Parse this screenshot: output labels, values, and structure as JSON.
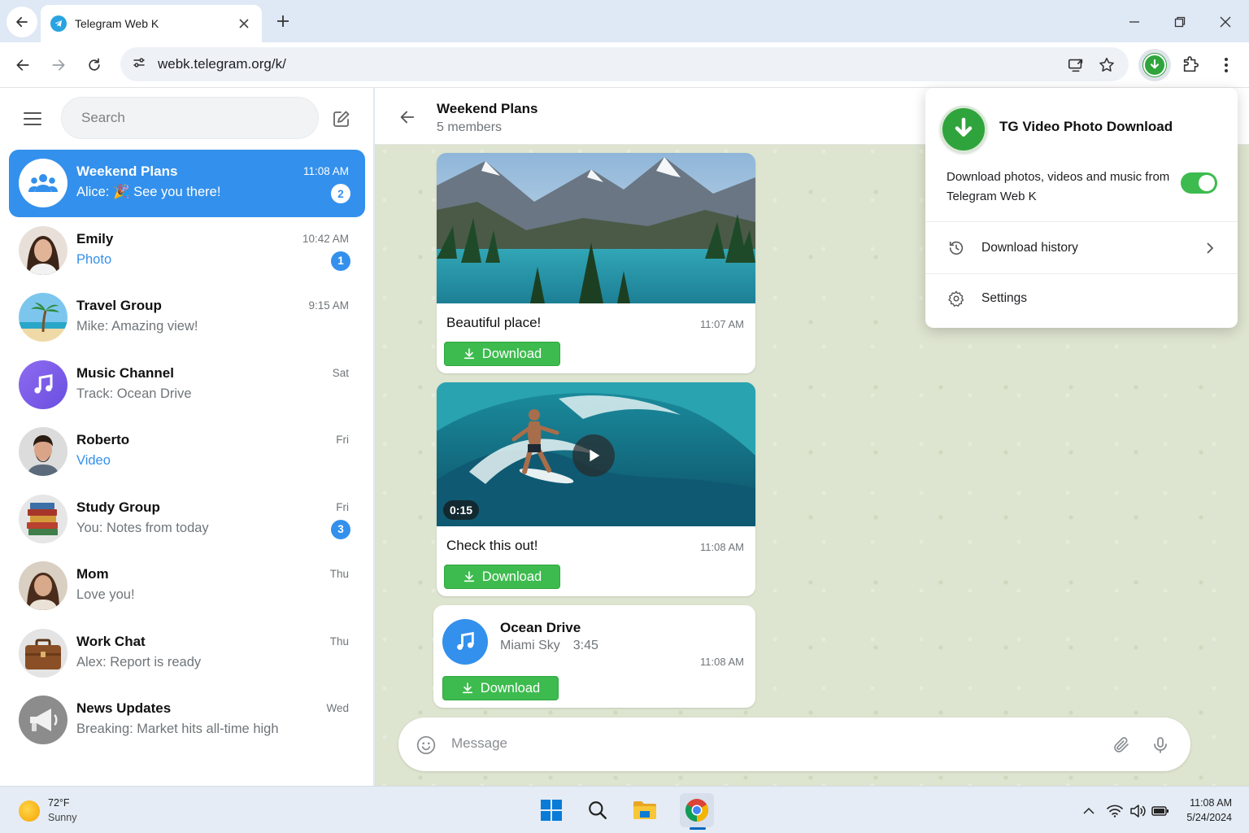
{
  "browser": {
    "tab_title": "Telegram Web K",
    "url": "webk.telegram.org/k/"
  },
  "sidebar": {
    "search_placeholder": "Search",
    "chats": [
      {
        "name": "Weekend Plans",
        "sender": "Alice:",
        "preview": "🎉 See you there!",
        "time": "11:08 AM",
        "badge": "2",
        "active": true
      },
      {
        "name": "Emily",
        "sender": "",
        "preview": "Photo",
        "time": "10:42 AM",
        "badge": "1",
        "media": true
      },
      {
        "name": "Travel Group",
        "sender": "",
        "preview": "Mike: Amazing view!",
        "time": "9:15 AM",
        "badge": ""
      },
      {
        "name": "Music Channel",
        "sender": "",
        "preview": "Track: Ocean Drive",
        "time": "Sat",
        "badge": ""
      },
      {
        "name": "Roberto",
        "sender": "",
        "preview": "Video",
        "time": "Fri",
        "badge": "",
        "media": true
      },
      {
        "name": "Study Group",
        "sender": "You:",
        "preview": "Notes from today",
        "time": "Fri",
        "badge": "3"
      },
      {
        "name": "Mom",
        "sender": "",
        "preview": "Love you!",
        "time": "Thu",
        "badge": ""
      },
      {
        "name": "Work Chat",
        "sender": "",
        "preview": "Alex: Report is ready",
        "time": "Thu",
        "badge": ""
      },
      {
        "name": "News Updates",
        "sender": "",
        "preview": "Breaking: Market hits all-time high",
        "time": "Wed",
        "badge": ""
      }
    ]
  },
  "chat": {
    "title": "Weekend Plans",
    "subtitle": "5 members",
    "messages": [
      {
        "type": "photo",
        "caption": "Beautiful place!",
        "time": "11:07 AM",
        "download_label": "Download"
      },
      {
        "type": "video",
        "caption": "Check this out!",
        "time": "11:08 AM",
        "duration": "0:15",
        "download_label": "Download"
      },
      {
        "type": "audio",
        "title": "Ocean Drive",
        "artist": "Miami Sky",
        "duration": "3:45",
        "time": "11:08 AM",
        "download_label": "Download"
      }
    ],
    "composer_placeholder": "Message"
  },
  "popup": {
    "title": "TG Video Photo Download",
    "description": "Download photos, videos and music from Telegram Web K",
    "toggle_on": true,
    "items": [
      {
        "label": "Download history",
        "icon": "history-icon"
      },
      {
        "label": "Settings",
        "icon": "gear-icon"
      }
    ]
  },
  "taskbar": {
    "temperature": "72°F",
    "condition": "Sunny",
    "time": "11:08 AM",
    "date": "5/24/2024"
  },
  "colors": {
    "accent": "#3390ec",
    "download_green": "#3dbb4e",
    "chat_bg": "#dde4cf"
  }
}
